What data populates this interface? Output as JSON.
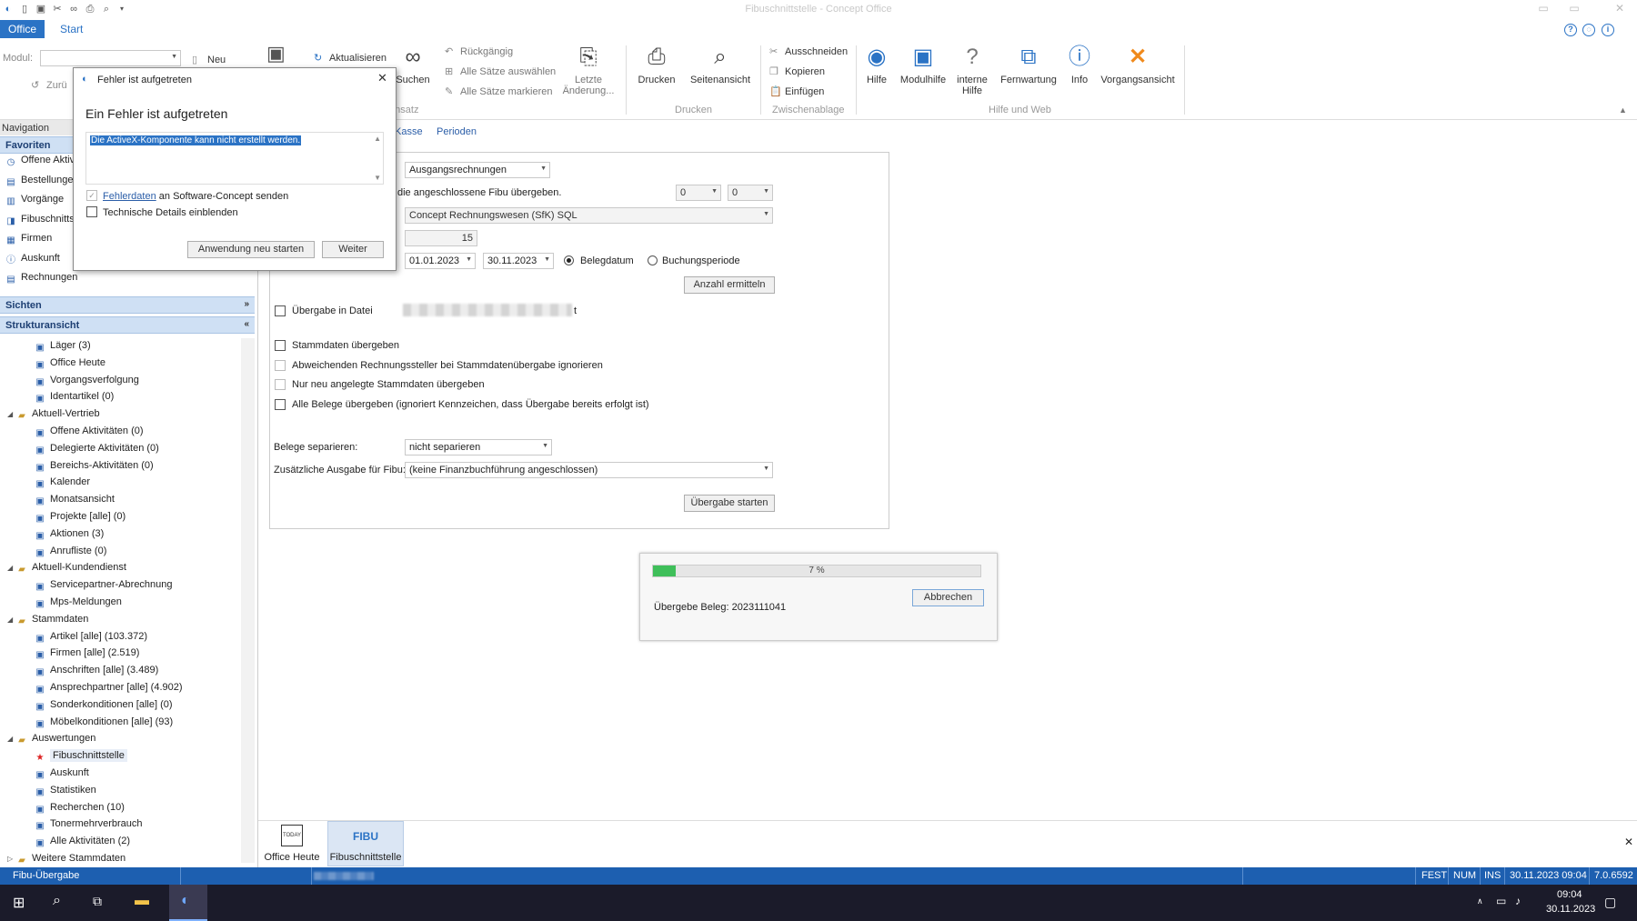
{
  "window": {
    "title": "Fibuschnittstelle - Concept Office"
  },
  "tabs": {
    "office": "Office",
    "start": "Start"
  },
  "ribbon": {
    "modul_label": "Modul:",
    "neu": "Neu",
    "zurueck": "Zurü",
    "aktualisieren": "Aktualisieren",
    "suchen": "Suchen",
    "rueckgaengig": "Rückgängig",
    "alle_saetze_auswaehlen": "Alle Sätze auswählen",
    "alle_saetze_markieren": "Alle Sätze markieren",
    "letzte_aenderung": "Letzte Änderung...",
    "datensatz_group": "tensatz",
    "drucken": "Drucken",
    "seitenansicht": "Seitenansicht",
    "drucken_group": "Drucken",
    "ausschneiden": "Ausschneiden",
    "kopieren": "Kopieren",
    "einfuegen": "Einfügen",
    "zwischenablage_group": "Zwischenablage",
    "hilfe": "Hilfe",
    "modulhilfe": "Modulhilfe",
    "interne_hilfe": "interne Hilfe",
    "fernwartung": "Fernwartung",
    "info": "Info",
    "vorgangsansicht": "Vorgangsansicht",
    "hilfe_web_group": "Hilfe und Web"
  },
  "nav": {
    "header": "Navigation",
    "favoriten": "Favoriten",
    "fav_items": [
      "Offene Aktiv",
      "Bestellunge",
      "Vorgänge",
      "Fibuschnitts",
      "Firmen",
      "Auskunft",
      "Rechnungen"
    ],
    "sichten": "Sichten",
    "strukturansicht": "Strukturansicht",
    "tree": [
      {
        "label": "Läger (3)",
        "level": 2
      },
      {
        "label": "Office Heute",
        "level": 2
      },
      {
        "label": "Vorgangsverfolgung",
        "level": 2
      },
      {
        "label": "Identartikel (0)",
        "level": 2
      },
      {
        "label": "Aktuell-Vertrieb",
        "level": 1
      },
      {
        "label": "Offene Aktivitäten (0)",
        "level": 2
      },
      {
        "label": "Delegierte Aktivitäten (0)",
        "level": 2
      },
      {
        "label": "Bereichs-Aktivitäten (0)",
        "level": 2
      },
      {
        "label": "Kalender",
        "level": 2
      },
      {
        "label": "Monatsansicht",
        "level": 2
      },
      {
        "label": "Projekte [alle] (0)",
        "level": 2
      },
      {
        "label": "Aktionen (3)",
        "level": 2
      },
      {
        "label": "Anrufliste (0)",
        "level": 2
      },
      {
        "label": "Aktuell-Kundendienst",
        "level": 1
      },
      {
        "label": "Servicepartner-Abrechnung",
        "level": 2
      },
      {
        "label": "Mps-Meldungen",
        "level": 2
      },
      {
        "label": "Stammdaten",
        "level": 1
      },
      {
        "label": "Artikel [alle] (103.372)",
        "level": 2
      },
      {
        "label": "Firmen [alle] (2.519)",
        "level": 2
      },
      {
        "label": "Anschriften [alle] (3.489)",
        "level": 2
      },
      {
        "label": "Ansprechpartner [alle] (4.902)",
        "level": 2
      },
      {
        "label": "Sonderkonditionen [alle] (0)",
        "level": 2
      },
      {
        "label": "Möbelkonditionen [alle] (93)",
        "level": 2
      },
      {
        "label": "Auswertungen",
        "level": 1
      },
      {
        "label": "Fibuschnittstelle",
        "level": 2
      },
      {
        "label": "Auskunft",
        "level": 2
      },
      {
        "label": "Statistiken",
        "level": 2
      },
      {
        "label": "Recherchen (10)",
        "level": 2
      },
      {
        "label": "Tonermehrverbrauch",
        "level": 2
      },
      {
        "label": "Alle Aktivitäten (2)",
        "level": 2
      },
      {
        "label": "Weitere Stammdaten",
        "level": 1
      }
    ]
  },
  "content": {
    "tabs": [
      "Kasse",
      "Perioden"
    ],
    "ausgangsrechnungen": "Ausgangsrechnungen",
    "fibu_text": "die angeschlossene Fibu übergeben.",
    "val1": "0",
    "val2": "0",
    "fibu_system": "Concept Rechnungswesen (SfK) SQL",
    "count": "15",
    "date_from": "01.01.2023",
    "date_to": "30.11.2023",
    "belegdatum": "Belegdatum",
    "buchungsperiode": "Buchungsperiode",
    "anzahl_ermitteln": "Anzahl ermitteln",
    "uebergabe_datei": "Übergabe in Datei",
    "file_suffix": "t",
    "stammdaten_uebergeben": "Stammdaten übergeben",
    "abweichenden": "Abweichenden Rechnungssteller bei Stammdatenübergabe ignorieren",
    "nur_neu": "Nur neu angelegte Stammdaten übergeben",
    "alle_belege": "Alle Belege übergeben (ignoriert Kennzeichen, dass Übergabe bereits erfolgt ist)",
    "belege_separieren_label": "Belege separieren:",
    "belege_separieren_value": "nicht separieren",
    "zusaetzliche_label": "Zusätzliche Ausgabe für Fibu:",
    "zusaetzliche_value": "(keine Finanzbuchführung angeschlossen)",
    "uebergabe_starten": "Übergabe starten"
  },
  "progress": {
    "percent": 7,
    "label": "7 %",
    "abbrechen": "Abbrechen",
    "status": "Übergebe Beleg: 2023111041"
  },
  "error_dialog": {
    "title": "Fehler ist aufgetreten",
    "heading": "Ein Fehler ist aufgetreten",
    "message": "Die ActiveX-Komponente kann nicht erstellt werden.",
    "fehlerdaten_link": "Fehlerdaten",
    "fehlerdaten_rest": "an Software-Concept senden",
    "technische_details": "Technische Details einblenden",
    "restart": "Anwendung neu starten",
    "weiter": "Weiter"
  },
  "bottom_tabs": [
    {
      "label": "Office Heute",
      "icon_text": "TODAY"
    },
    {
      "label": "Fibuschnittstelle",
      "icon_text": "FIBU"
    }
  ],
  "status": {
    "left": "Fibu-Übergabe",
    "fest": "FEST",
    "num": "NUM",
    "ins": "INS",
    "datetime": "30.11.2023 09:04",
    "version": "7.0.6592"
  },
  "taskbar": {
    "time": "09:04",
    "date": "30.11.2023"
  },
  "colors": {
    "accent": "#2b73c5",
    "status_bar": "#1d5fb0",
    "progress": "#3fbf5a",
    "section": "#cfe0f4"
  }
}
